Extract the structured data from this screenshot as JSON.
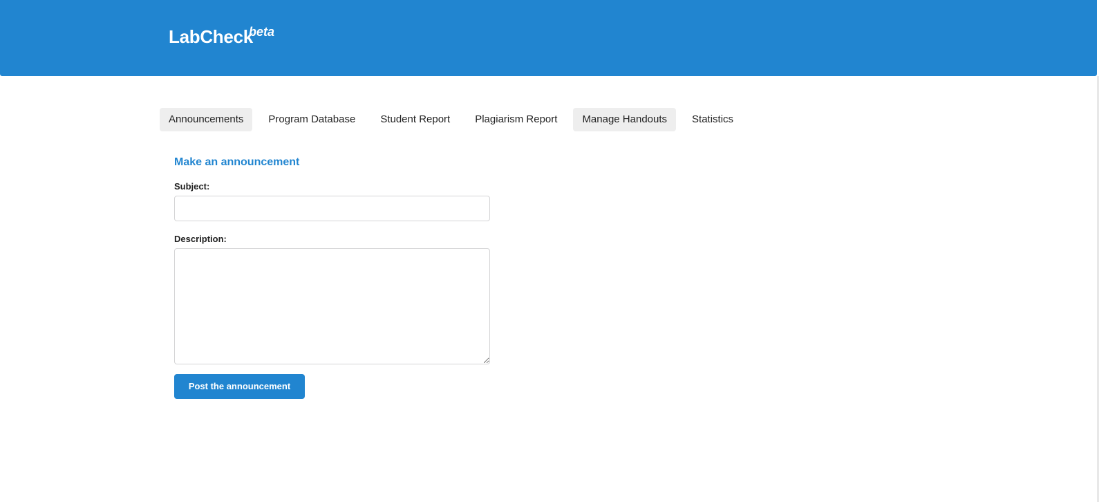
{
  "header": {
    "brand": "LabCheck",
    "brand_tag": "beta",
    "background_color": "#2185d0"
  },
  "tabs": [
    {
      "label": "Announcements",
      "active": true
    },
    {
      "label": "Program Database",
      "active": false
    },
    {
      "label": "Student Report",
      "active": false
    },
    {
      "label": "Plagiarism Report",
      "active": false
    },
    {
      "label": "Manage Handouts",
      "active": false,
      "hovered": true
    },
    {
      "label": "Statistics",
      "active": false
    }
  ],
  "form": {
    "title": "Make an announcement",
    "subject_label": "Subject:",
    "subject_value": "",
    "description_label": "Description:",
    "description_value": "",
    "submit_label": "Post the announcement"
  },
  "colors": {
    "accent": "#2185d0",
    "tab_active_bg": "#eeeeee"
  }
}
